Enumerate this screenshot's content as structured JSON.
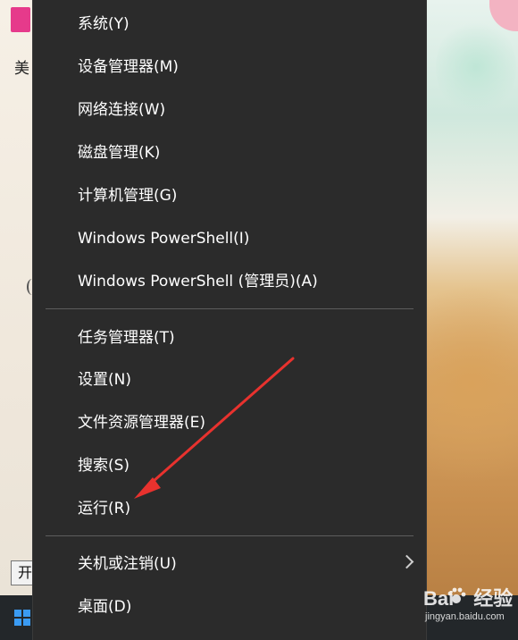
{
  "desktop": {
    "icon_label": "美",
    "start_tooltip": "开始"
  },
  "menu": {
    "group1": [
      {
        "label": "系统(Y)"
      },
      {
        "label": "设备管理器(M)"
      },
      {
        "label": "网络连接(W)"
      },
      {
        "label": "磁盘管理(K)"
      },
      {
        "label": "计算机管理(G)"
      },
      {
        "label": "Windows PowerShell(I)"
      },
      {
        "label": "Windows PowerShell (管理员)(A)"
      }
    ],
    "group2": [
      {
        "label": "任务管理器(T)"
      },
      {
        "label": "设置(N)"
      },
      {
        "label": "文件资源管理器(E)"
      },
      {
        "label": "搜索(S)"
      },
      {
        "label": "运行(R)"
      }
    ],
    "group3": [
      {
        "label": "关机或注销(U)",
        "has_submenu": true,
        "icon": "chevron-right-icon"
      },
      {
        "label": "桌面(D)"
      }
    ]
  },
  "annotation": {
    "type": "red-arrow",
    "color": "#e8322e",
    "points_to": "运行(R)"
  },
  "watermark": {
    "logo_text": "Bai",
    "logo_text2": "经验",
    "url": "jingyan.baidu.com"
  },
  "colors": {
    "menu_bg": "#2b2b2b",
    "menu_text": "#ffffff",
    "separator": "#5d5d5d",
    "taskbar": "#23272a",
    "windows_logo": "#3a9bf3"
  }
}
